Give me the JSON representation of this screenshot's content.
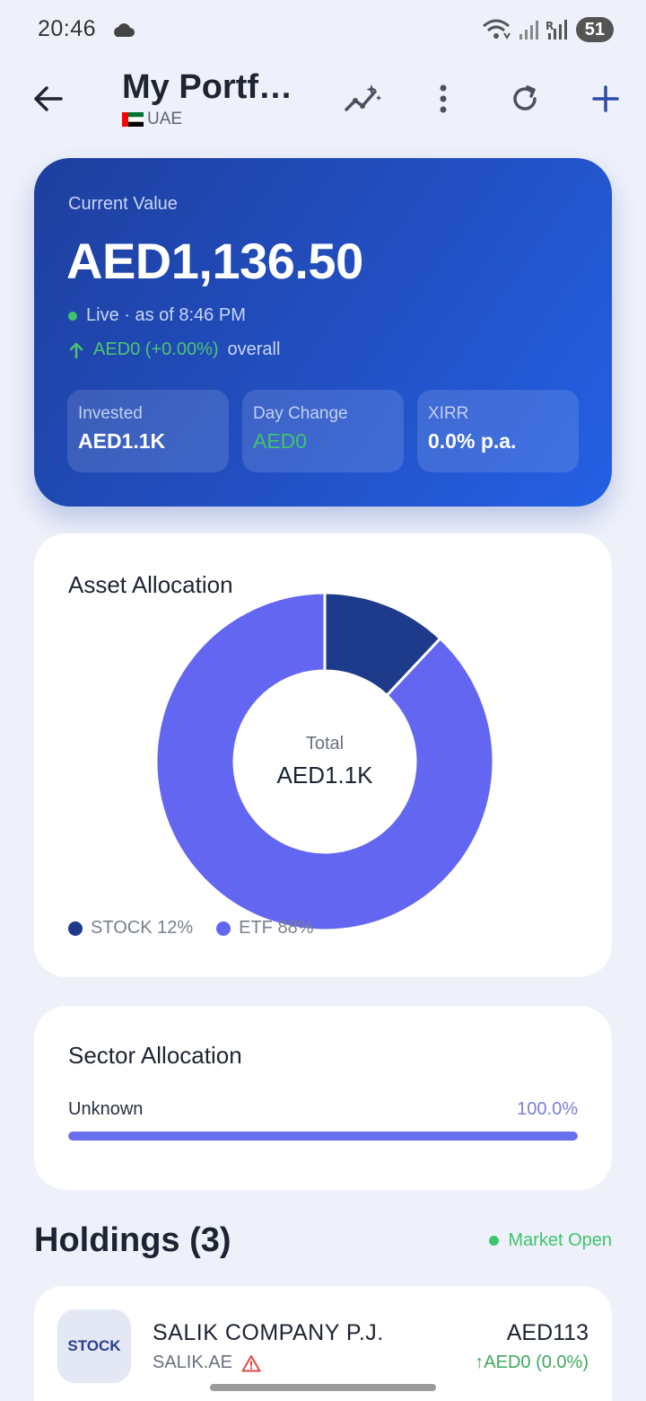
{
  "status_bar": {
    "time": "20:46",
    "battery": "51",
    "icons": [
      "cloud-icon",
      "wifi-icon",
      "signal-icon",
      "signal-r-icon"
    ]
  },
  "app_bar": {
    "title": "My Portf…",
    "country": "UAE",
    "icons": [
      "back-arrow-icon",
      "sparkle-trend-icon",
      "more-vert-icon",
      "refresh-icon",
      "plus-icon"
    ]
  },
  "summary": {
    "label": "Current Value",
    "value": "AED1,136.50",
    "live_text": "Live · as of 8:46 PM",
    "gain_amount": "AED0 (+0.00%)",
    "gain_suffix": "overall",
    "stats": [
      {
        "label": "Invested",
        "value": "AED1.1K"
      },
      {
        "label": "Day Change",
        "value": "AED0"
      },
      {
        "label": "XIRR",
        "value": "0.0% p.a."
      }
    ]
  },
  "asset_allocation": {
    "title": "Asset Allocation",
    "center_label": "Total",
    "center_value": "AED1.1K",
    "legend": [
      {
        "label": "STOCK 12%",
        "color": "#1e3a8a"
      },
      {
        "label": "ETF 88%",
        "color": "#6366f1"
      }
    ]
  },
  "chart_data": {
    "type": "pie",
    "categories": [
      "STOCK",
      "ETF"
    ],
    "values": [
      12,
      88
    ],
    "colors": [
      "#1e3a8a",
      "#6366f1"
    ]
  },
  "sector_allocation": {
    "title": "Sector Allocation",
    "sectors": [
      {
        "name": "Unknown",
        "percent_label": "100.0%",
        "fraction": 1.0
      }
    ]
  },
  "holdings": {
    "title": "Holdings (3)",
    "market_status": "Market Open",
    "items": [
      {
        "badge": "STOCK",
        "name": "SALIK COMPANY P.J.",
        "ticker": "SALIK.AE",
        "value": "AED113",
        "change": "↑AED0 (0.0%)"
      }
    ]
  }
}
